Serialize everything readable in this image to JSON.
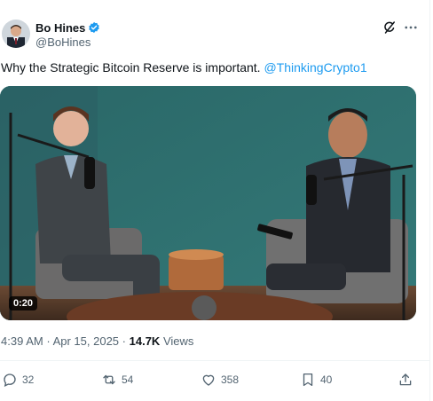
{
  "author": {
    "name": "Bo Hines",
    "handle": "@BoHines",
    "verified": true
  },
  "tweet": {
    "text": "Why the Strategic Bitcoin Reserve is important.",
    "mention": "@ThinkingCrypto1"
  },
  "media": {
    "type": "video",
    "duration": "0:20"
  },
  "meta": {
    "time": "4:39 AM",
    "separator": "·",
    "date": "Apr 15, 2025",
    "views_count": "14.7K",
    "views_label": "Views"
  },
  "actions": {
    "replies": "32",
    "reposts": "54",
    "likes": "358",
    "bookmarks": "40"
  },
  "icons": {
    "grok": "grok-icon",
    "more": "more-icon",
    "reply": "reply-icon",
    "repost": "repost-icon",
    "like": "heart-icon",
    "bookmark": "bookmark-icon",
    "share": "share-icon"
  },
  "colors": {
    "accent": "#1d9bf0",
    "secondary_text": "#536471",
    "primary_text": "#0f1419"
  }
}
